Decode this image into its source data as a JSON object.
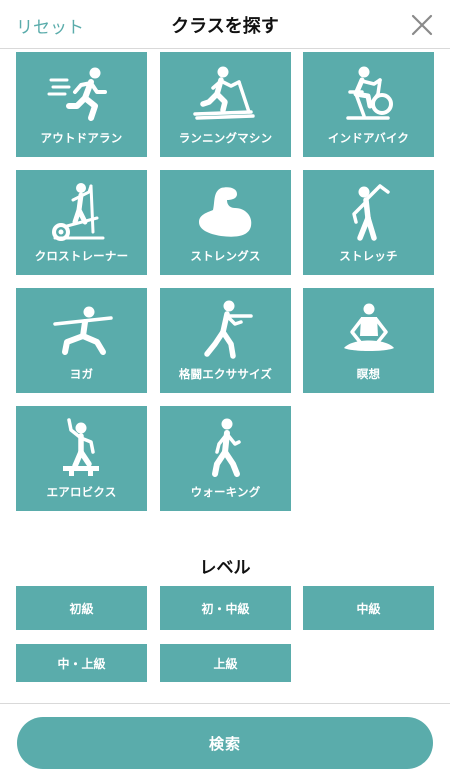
{
  "header": {
    "reset_label": "リセット",
    "title": "クラスを探す"
  },
  "classes": [
    {
      "label": "アウトドアラン",
      "icon": "outdoor-run-icon"
    },
    {
      "label": "ランニングマシン",
      "icon": "treadmill-icon"
    },
    {
      "label": "インドアバイク",
      "icon": "indoor-bike-icon"
    },
    {
      "label": "クロストレーナー",
      "icon": "cross-trainer-icon"
    },
    {
      "label": "ストレングス",
      "icon": "strength-arm-icon"
    },
    {
      "label": "ストレッチ",
      "icon": "stretch-icon"
    },
    {
      "label": "ヨガ",
      "icon": "yoga-icon"
    },
    {
      "label": "格闘エクササイズ",
      "icon": "boxing-icon"
    },
    {
      "label": "瞑想",
      "icon": "meditation-icon"
    },
    {
      "label": "エアロビクス",
      "icon": "aerobics-step-icon"
    },
    {
      "label": "ウォーキング",
      "icon": "walking-icon"
    }
  ],
  "levels": {
    "title": "レベル",
    "items": [
      "初級",
      "初・中級",
      "中級",
      "中・上級",
      "上級"
    ]
  },
  "footer": {
    "search_label": "検索"
  },
  "colors": {
    "accent": "#5aacab",
    "divider": "#d9d9d9"
  }
}
